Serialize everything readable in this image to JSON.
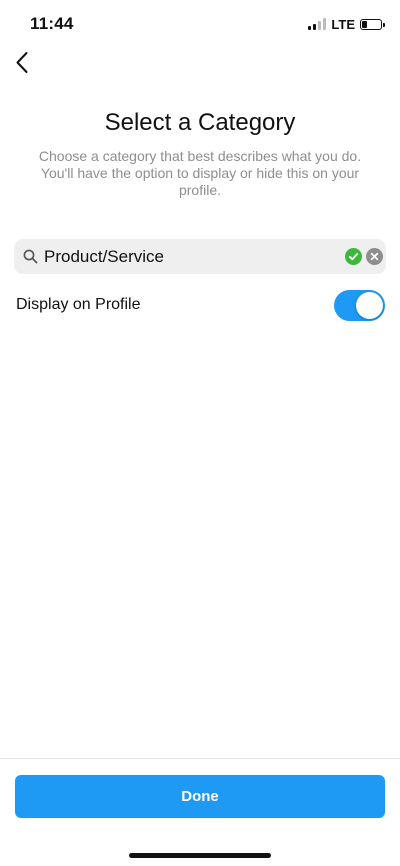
{
  "status_bar": {
    "time": "11:44",
    "network": "LTE",
    "signal_bars_active": 2,
    "signal_bars_total": 4,
    "battery_level": 0.3
  },
  "nav": {
    "back_icon": "chevron-left-icon"
  },
  "header": {
    "title": "Select a Category",
    "subtitle": "Choose a category that best describes what you do. You'll have the option to display or hide this on your profile."
  },
  "search": {
    "value": "Product/Service",
    "search_icon": "search-icon",
    "valid_icon": "check-circle-icon",
    "clear_icon": "clear-circle-icon"
  },
  "display_setting": {
    "label": "Display on Profile",
    "enabled": true
  },
  "footer": {
    "done_label": "Done"
  },
  "colors": {
    "accent": "#1e9af5",
    "valid_green": "#3db83b",
    "subtitle_gray": "#8e8e8e",
    "field_bg": "#efefef",
    "clear_gray": "#8e8e8e"
  }
}
